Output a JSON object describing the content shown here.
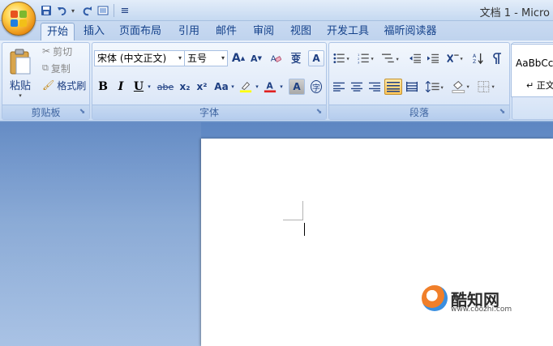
{
  "window": {
    "title": "文档 1 - Micro"
  },
  "quick_access": {
    "separator_glyph": "≡"
  },
  "tabs": [
    {
      "label": "开始",
      "active": true
    },
    {
      "label": "插入"
    },
    {
      "label": "页面布局"
    },
    {
      "label": "引用"
    },
    {
      "label": "邮件"
    },
    {
      "label": "审阅"
    },
    {
      "label": "视图"
    },
    {
      "label": "开发工具"
    },
    {
      "label": "福昕阅读器"
    }
  ],
  "clipboard": {
    "paste": "粘贴",
    "cut": "剪切",
    "copy": "复制",
    "format_painter": "格式刷",
    "group_label": "剪贴板"
  },
  "font": {
    "font_name": "宋体 (中文正文)",
    "font_size": "五号",
    "bold": "B",
    "italic": "I",
    "underline": "U",
    "strike": "abe",
    "subscript": "x₂",
    "superscript": "x²",
    "change_case": "Aa",
    "grow": "A",
    "shrink": "A",
    "phonetic": "变",
    "border_char": "A",
    "shade_char": "A",
    "enclose": "字",
    "group_label": "字体"
  },
  "paragraph": {
    "group_label": "段落"
  },
  "styles": {
    "sample_text": "AaBbCc",
    "style_name": "↵ 正文"
  },
  "watermark": {
    "brand": "酷知网",
    "url": "www.coozhi.com"
  }
}
